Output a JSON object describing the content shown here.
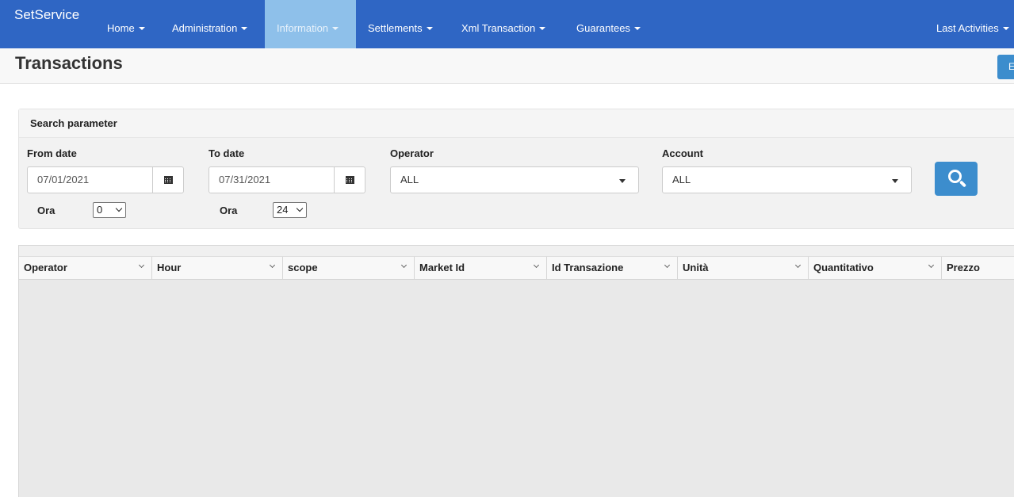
{
  "navbar": {
    "brand": "SetService",
    "items": [
      {
        "label": "Home"
      },
      {
        "label": "Administration"
      },
      {
        "label": "Information"
      },
      {
        "label": "Settlements"
      },
      {
        "label": "Xml Transaction"
      },
      {
        "label": "Guarantees"
      }
    ],
    "right_item": "Last Activities",
    "active_item": "Information",
    "colors": {
      "bar": "#2f66c4",
      "active": "#8ec0ea"
    }
  },
  "header": {
    "title": "Transactions",
    "button_label": "E"
  },
  "search": {
    "heading": "Search parameter",
    "from_date_label": "From date",
    "from_date_value": "07/01/2021",
    "to_date_label": "To date",
    "to_date_value": "07/31/2021",
    "ora_label_from": "Ora",
    "ora_from_value": "0",
    "ora_label_to": "Ora",
    "ora_to_value": "24",
    "operator_label": "Operator",
    "operator_value": "ALL",
    "account_label": "Account",
    "account_value": "ALL"
  },
  "grid": {
    "columns": [
      "Operator",
      "Hour",
      "scope",
      "Market Id",
      "Id Transazione",
      "Unità",
      "Quantitativo",
      "Prezzo"
    ]
  }
}
